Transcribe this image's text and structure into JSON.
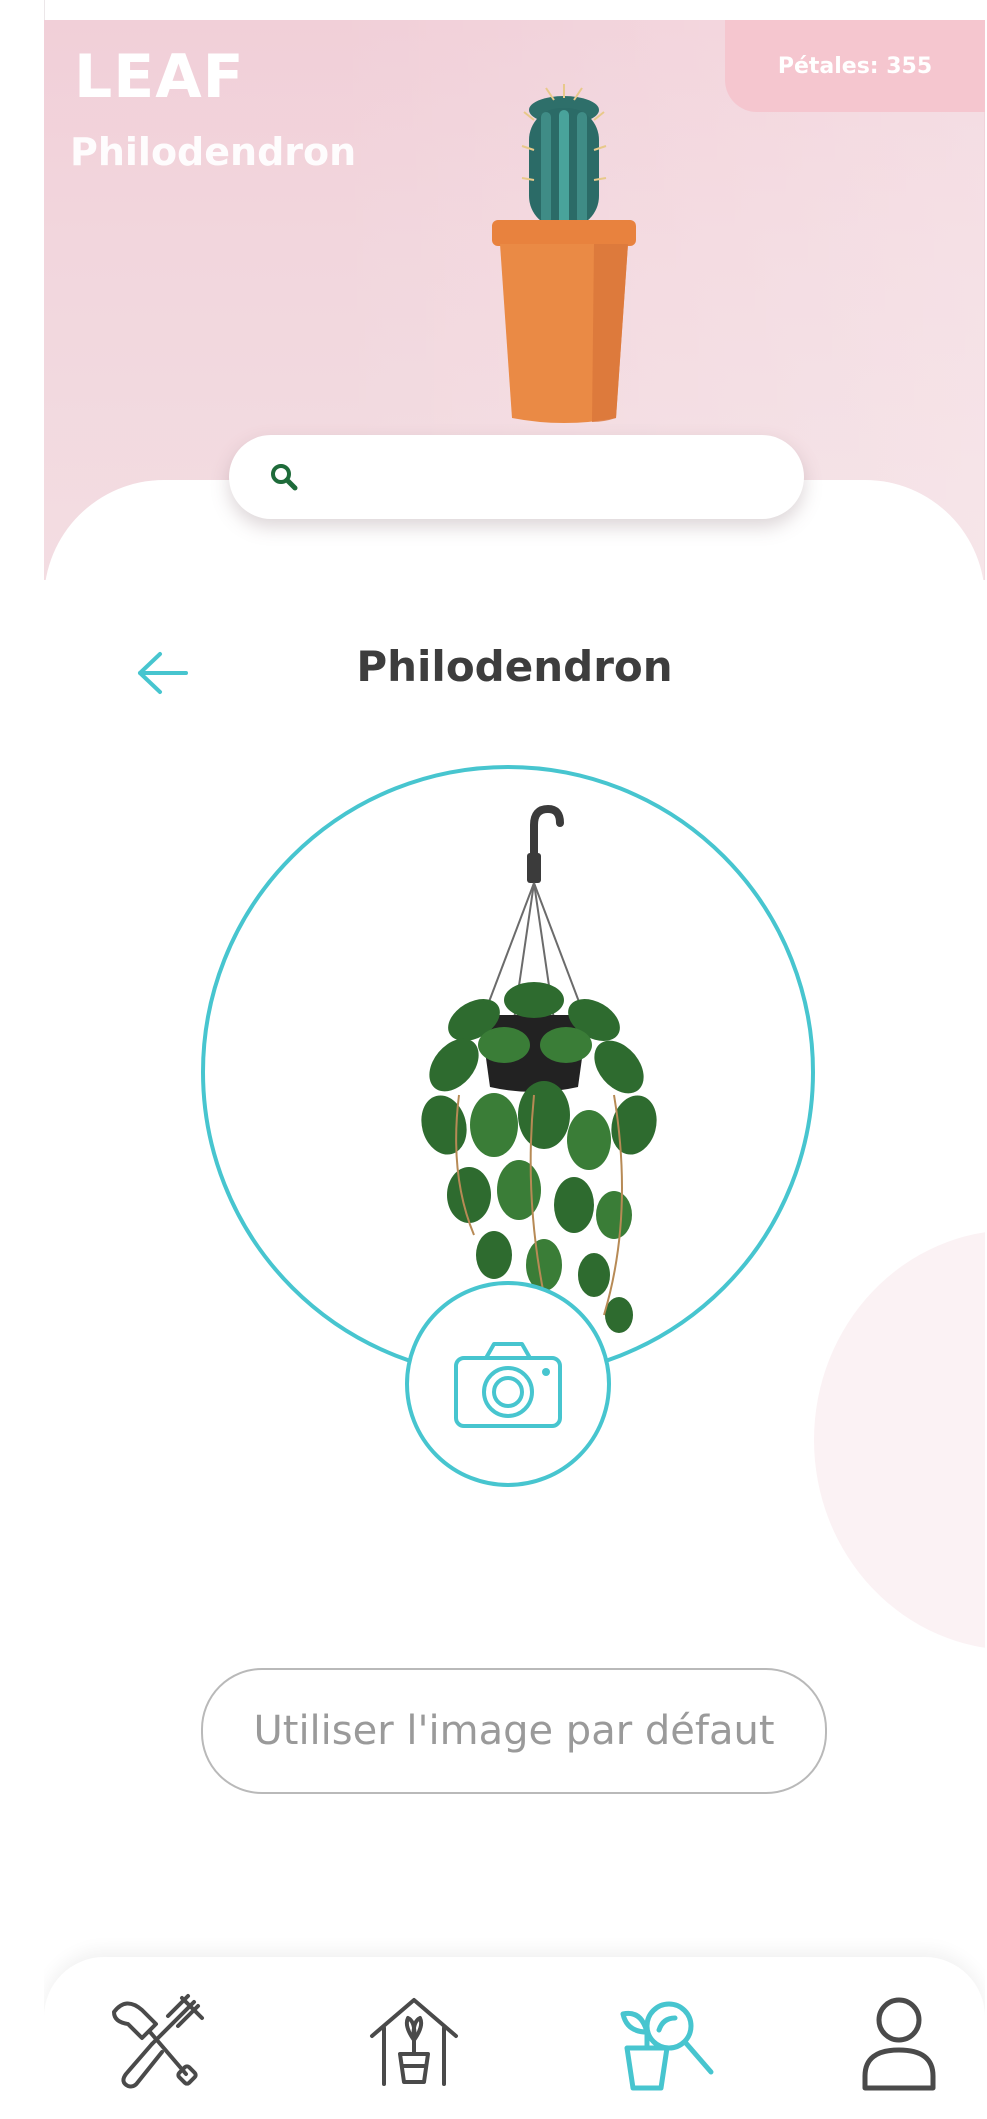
{
  "header": {
    "brand": "LEAF",
    "subtitle": "Philodendron",
    "petals": "Pétales: 355"
  },
  "search": {
    "placeholder": "",
    "value": ""
  },
  "detail": {
    "title": "Philodendron",
    "default_image_button": "Utiliser l'image par défaut"
  },
  "nav": {
    "items": [
      {
        "icon": "garden-tools-icon",
        "active": false
      },
      {
        "icon": "plant-house-icon",
        "active": false
      },
      {
        "icon": "plant-search-icon",
        "active": true
      },
      {
        "icon": "user-icon",
        "active": false
      }
    ]
  },
  "colors": {
    "accent": "#47c5cf",
    "hero_pink": "#f1cfd8",
    "badge_pink": "#f5c6cf",
    "icon_gray": "#4a4a4a",
    "search_icon_green": "#1e6b3a"
  }
}
